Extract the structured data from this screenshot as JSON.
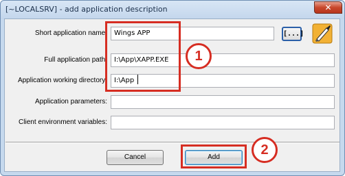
{
  "window": {
    "title": "[~LOCALSRV] - add application description",
    "close_glyph": "✕"
  },
  "form": {
    "short_name": {
      "label": "Short application name:",
      "value": "Wings APP"
    },
    "full_path": {
      "label": "Full application path:",
      "value": "I:\\App\\XAPP.EXE"
    },
    "working_dir": {
      "label": "Application working directory:",
      "value": "I:\\App"
    },
    "parameters": {
      "label": "Application parameters:",
      "value": ""
    },
    "client_env": {
      "label": "Client environment variables:",
      "value": ""
    },
    "browse_label": "[...]"
  },
  "buttons": {
    "cancel": "Cancel",
    "add": "Add"
  },
  "annotations": {
    "step1": "1",
    "step2": "2",
    "color": "#d62d22"
  },
  "icons": {
    "app_icon": "paint-brush-arrow-icon"
  }
}
